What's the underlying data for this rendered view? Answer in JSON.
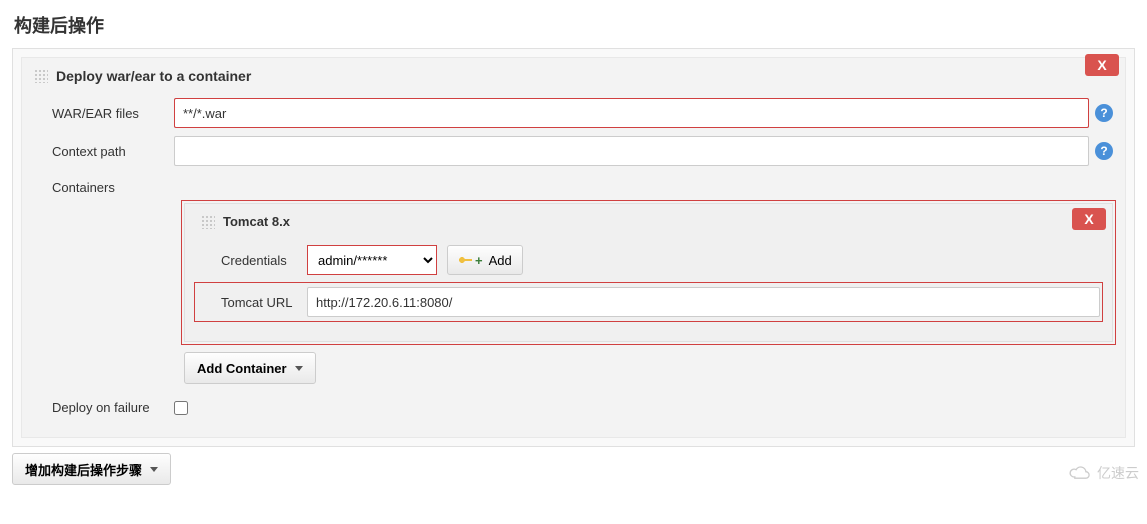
{
  "section_title": "构建后操作",
  "block": {
    "title": "Deploy war/ear to a container",
    "delete_label": "X",
    "fields": {
      "war_ear_label": "WAR/EAR files",
      "war_ear_value": "**/*.war",
      "context_path_label": "Context path",
      "context_path_value": "",
      "containers_label": "Containers",
      "deploy_on_failure_label": "Deploy on failure"
    },
    "container": {
      "title": "Tomcat 8.x",
      "delete_label": "X",
      "credentials_label": "Credentials",
      "credentials_value": "admin/******",
      "add_cred_label": "Add",
      "tomcat_url_label": "Tomcat URL",
      "tomcat_url_value": "http://172.20.6.11:8080/"
    },
    "add_container_label": "Add Container"
  },
  "add_step_label": "增加构建后操作步骤",
  "watermark": "亿速云"
}
